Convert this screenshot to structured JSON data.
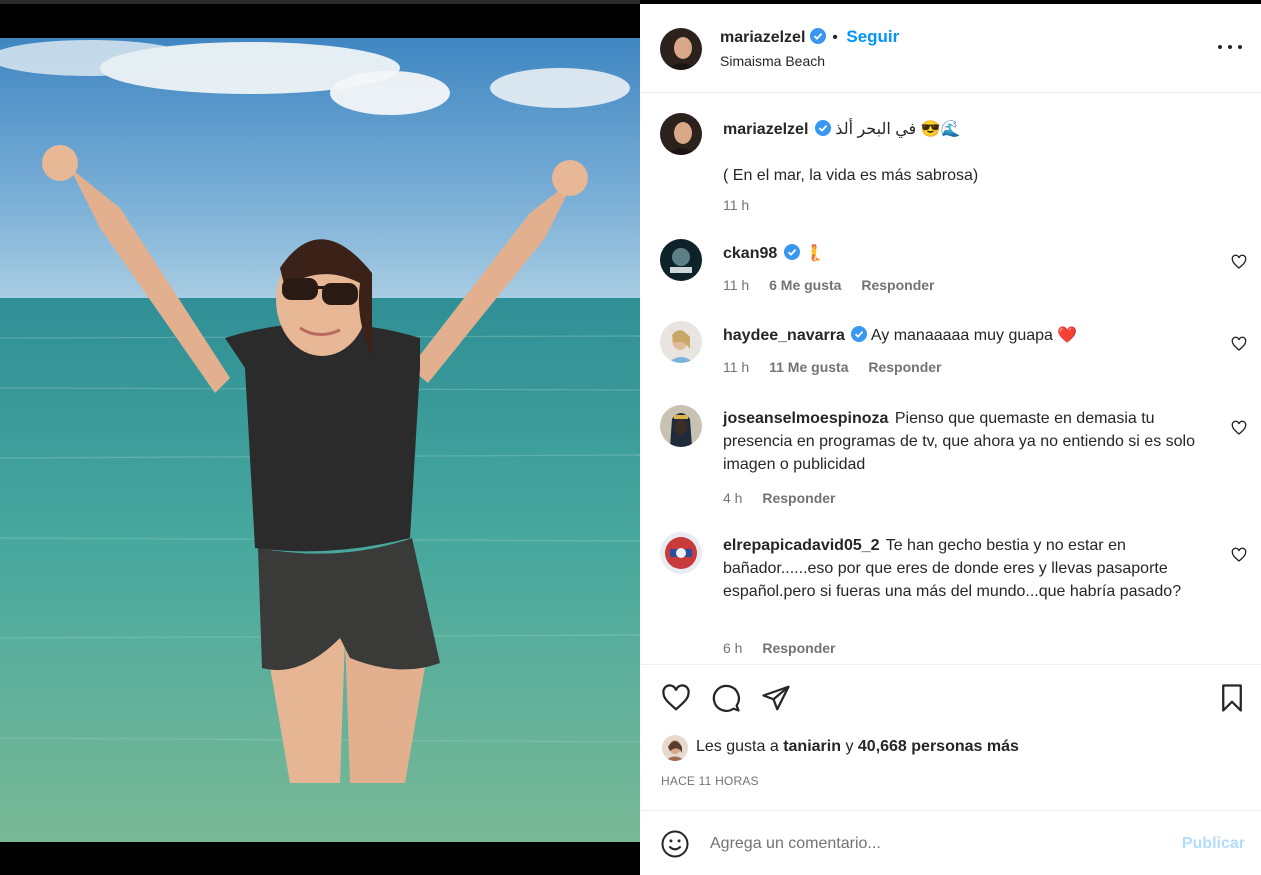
{
  "post": {
    "author": "mariazelzel",
    "follow_label": "Seguir",
    "dot": "•",
    "location": "Simaisma Beach",
    "more_label": "more-options"
  },
  "caption": {
    "username": "mariazelzel",
    "arabic_text": "في البحر ألذ",
    "emoji": "😎🌊",
    "translation": "( En el mar, la vida es más sabrosa)",
    "time": "11 h"
  },
  "comments": [
    {
      "username": "ckan98",
      "text": "",
      "emoji": "🧜",
      "time": "11 h",
      "likes": "6 Me gusta",
      "reply": "Responder",
      "verified": true
    },
    {
      "username": "haydee_navarra",
      "text": "Ay manaaaaa muy guapa",
      "emoji": "❤️",
      "time": "11 h",
      "likes": "11 Me gusta",
      "reply": "Responder",
      "verified": true
    },
    {
      "username": "joseanselmoespinoza",
      "text": "Pienso que quemaste en demasia tu presencia en programas de tv, que ahora ya no entiendo si es solo imagen o publicidad",
      "emoji": "",
      "time": "4 h",
      "likes": "",
      "reply": "Responder",
      "verified": false
    },
    {
      "username": "elrepapicadavid05_2",
      "text": "Te han gecho bestia y no estar en bañador......eso por que eres de donde eres y llevas pasaporte español.pero si fueras una más del mundo...que habría pasado?",
      "emoji": "",
      "time": "6 h",
      "likes": "",
      "reply": "Responder",
      "verified": false
    }
  ],
  "likes": {
    "prefix": "Les gusta a",
    "user": "taniarin",
    "conj": "y",
    "others": "40,668 personas más"
  },
  "timestamp": "HACE 11 HORAS",
  "add_comment": {
    "placeholder": "Agrega un comentario...",
    "publish_label": "Publicar"
  },
  "icons": [
    "like-icon",
    "comment-icon",
    "share-icon",
    "save-icon",
    "emoji-icon",
    "verified-icon",
    "heart-icon"
  ],
  "colors": {
    "accent": "#0095f6",
    "publish_disabled": "#b3dbff",
    "muted": "#737373",
    "verified": "#3897f0"
  }
}
